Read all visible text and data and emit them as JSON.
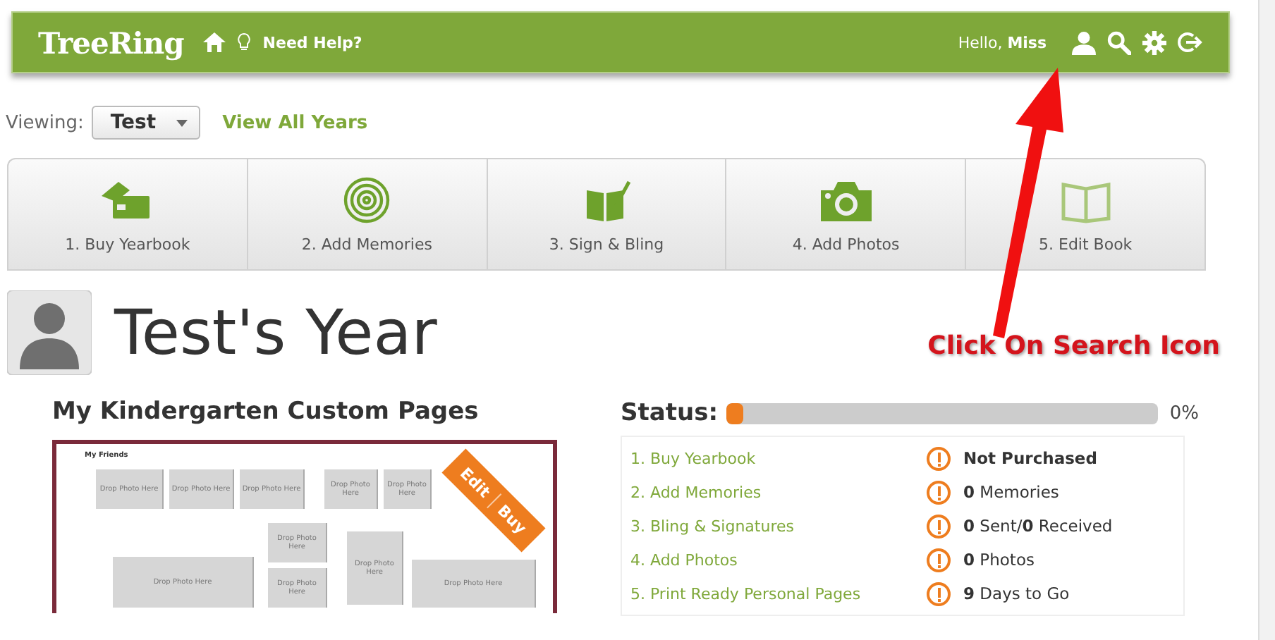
{
  "header": {
    "logo": "TreeRing",
    "help": "Need Help?",
    "greeting": "Hello, **Miss**"
  },
  "viewing": {
    "label": "Viewing:",
    "value": "Test",
    "link": "View All Years"
  },
  "steps": [
    {
      "label": "1. Buy Yearbook",
      "disabled": false
    },
    {
      "label": "2. Add Memories",
      "disabled": false
    },
    {
      "label": "3. Sign & Bling",
      "disabled": false
    },
    {
      "label": "4. Add Photos",
      "disabled": false
    },
    {
      "label": "5. Edit Book",
      "disabled": true
    }
  ],
  "title": "Test's Year",
  "annotation": "Click On Search Icon",
  "pages": {
    "title": "My Kindergarten Custom Pages",
    "heading": "My Friends",
    "ribbon": [
      "Edit",
      "Buy"
    ],
    "slots": [
      "Drop Photo Here",
      "Drop Photo Here",
      "Drop Photo Here",
      "Drop Photo Here",
      "Drop Photo Here",
      "Drop Photo Here",
      "Drop Photo Here",
      "Drop Photo Here",
      "Drop Photo Here",
      "Drop Photo Here"
    ]
  },
  "status": {
    "label": "Status:",
    "level": 0,
    "percent": "0%",
    "items": [
      {
        "step": "1. Buy Yearbook",
        "value": "**Not Purchased**"
      },
      {
        "step": "2. Add Memories",
        "value": "**0** Memories"
      },
      {
        "step": "3. Bling & Signatures",
        "value": "**0** Sent/**0** Received"
      },
      {
        "step": "4. Add Photos",
        "value": "**0** Photos"
      },
      {
        "step": "5. Print Ready Personal Pages",
        "value": "**9** Days to Go"
      }
    ]
  }
}
